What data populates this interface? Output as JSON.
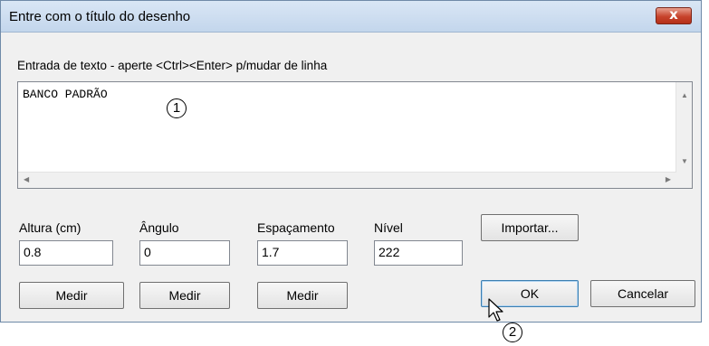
{
  "dialog": {
    "title": "Entre com o título do desenho",
    "close_symbol": "x"
  },
  "text_entry": {
    "label": "Entrada de texto - aperte <Ctrl><Enter> p/mudar de linha",
    "value": "BANCO PADRÃO"
  },
  "fields": [
    {
      "label": "Altura (cm)",
      "value": "0.8",
      "button": "Medir"
    },
    {
      "label": "Ângulo",
      "value": "0",
      "button": "Medir"
    },
    {
      "label": "Espaçamento",
      "value": "1.7",
      "button": "Medir"
    },
    {
      "label": "Nível",
      "value": "222"
    }
  ],
  "buttons": {
    "importar": "Importar...",
    "ok": "OK",
    "cancelar": "Cancelar"
  },
  "callouts": [
    "1",
    "2"
  ],
  "icons": [
    "close-icon",
    "scroll-up-icon",
    "scroll-down-icon",
    "scroll-left-icon",
    "scroll-right-icon",
    "mouse-pointer-icon"
  ]
}
